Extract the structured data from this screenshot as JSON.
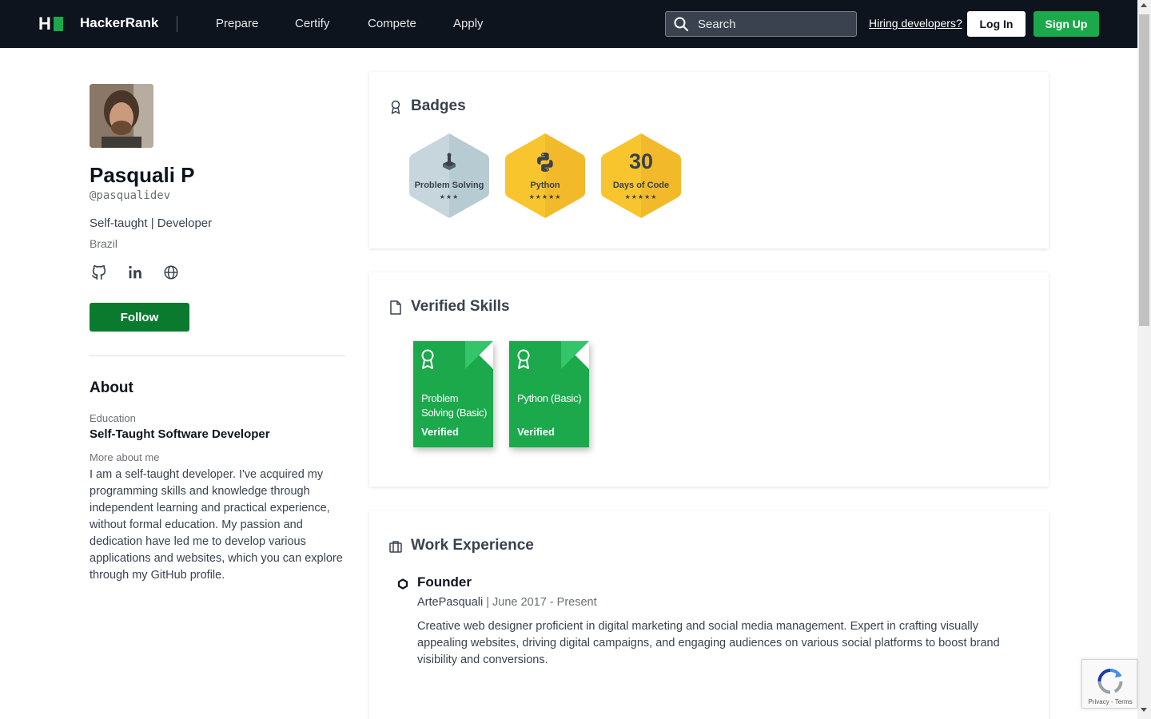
{
  "nav": {
    "brand": "HackerRank",
    "links": [
      "Prepare",
      "Certify",
      "Compete",
      "Apply"
    ],
    "search_placeholder": "Search",
    "hiring_link": "Hiring developers?",
    "login_label": "Log In",
    "signup_label": "Sign Up"
  },
  "profile": {
    "name": "Pasquali P",
    "handle": "@pasqualidev",
    "headline": "Self-taught | Developer",
    "country": "Brazil",
    "socials": [
      "github-icon",
      "linkedin-icon",
      "globe-icon"
    ],
    "follow_label": "Follow",
    "about_title": "About",
    "education_label": "Education",
    "education_value": "Self-Taught Software Developer",
    "more_label": "More about me",
    "more_text": "I am a self-taught developer. I've acquired my programming skills and knowledge through independent learning and practical experience, without formal education. My passion and dedication have led me to develop various applications and websites, which you can explore through my GitHub profile."
  },
  "badges": {
    "title": "Badges",
    "items": [
      {
        "name": "Problem Solving",
        "stars": "★★★",
        "icon": "problem-solving-icon",
        "tier": "silver"
      },
      {
        "name": "Python",
        "stars": "★★★★★",
        "icon": "python-icon",
        "tier": "gold"
      },
      {
        "name": "Days of Code",
        "number": "30",
        "stars": "★★★★★",
        "tier": "gold"
      }
    ],
    "colors": {
      "silver": "#c6d6dc",
      "gold": "#f8c52f"
    }
  },
  "skills": {
    "title": "Verified Skills",
    "items": [
      {
        "name": "Problem Solving (Basic)",
        "status": "Verified"
      },
      {
        "name": "Python (Basic)",
        "status": "Verified"
      }
    ]
  },
  "work": {
    "title": "Work Experience",
    "items": [
      {
        "role": "Founder",
        "company": "ArtePasquali",
        "separator": " | ",
        "dates": "June 2017 - Present",
        "description": "Creative web designer proficient in digital marketing and social media management. Expert in crafting visually appealing websites, driving digital campaigns, and engaging audiences on various social platforms to boost brand visibility and conversions."
      }
    ]
  },
  "recaptcha": {
    "text": "Privacy - Terms"
  },
  "colors": {
    "accent": "#1ba94c",
    "nav_bg": "#0e141e",
    "follow": "#0a7b2e"
  }
}
